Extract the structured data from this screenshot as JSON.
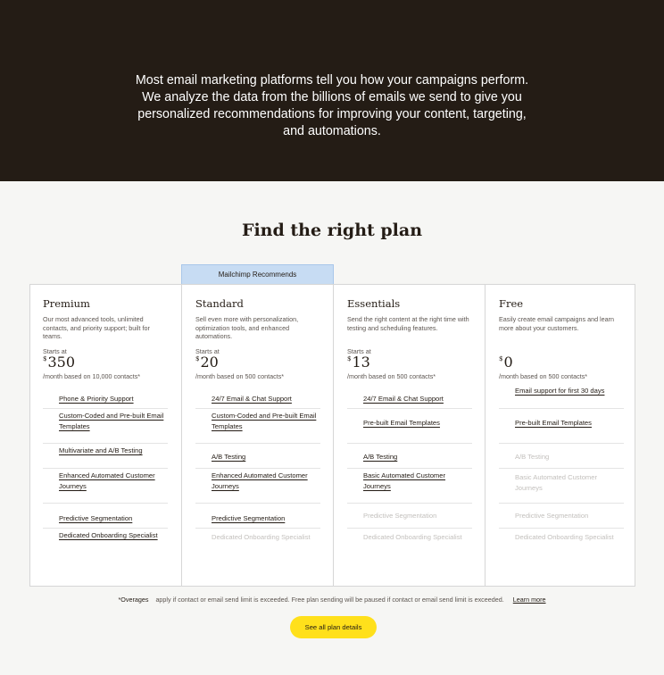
{
  "hero": {
    "text": "Most email marketing platforms tell you how your campaigns perform. We analyze the data from the billions of emails we send to give you personalized recommendations for improving your content, targeting, and automations."
  },
  "plans_section": {
    "title": "Find the right plan",
    "recommended_label": "Mailchimp Recommends"
  },
  "plans": [
    {
      "name": "Premium",
      "description": "Our most advanced tools, unlimited contacts, and priority support; built for teams.",
      "starts_at": "Starts at",
      "currency": "$",
      "price": "350",
      "per_month": "/month based on 10,000 contacts*",
      "features": [
        {
          "label": "Phone & Priority Support",
          "included": true
        },
        {
          "label": "Custom-Coded and Pre-built Email Templates",
          "included": true
        },
        {
          "label": "Multivariate and A/B Testing",
          "included": true
        },
        {
          "label": "Enhanced Automated Customer Journeys",
          "included": true
        },
        {
          "label": "Predictive Segmentation",
          "included": true
        },
        {
          "label": "Dedicated Onboarding Specialist",
          "included": true
        }
      ]
    },
    {
      "name": "Standard",
      "description": "Sell even more with personalization, optimization tools, and enhanced automations.",
      "starts_at": "Starts at",
      "currency": "$",
      "price": "20",
      "per_month": "/month based on 500 contacts*",
      "features": [
        {
          "label": "24/7 Email & Chat Support",
          "included": true
        },
        {
          "label": "Custom-Coded and Pre-built Email Templates",
          "included": true
        },
        {
          "label": "A/B Testing",
          "included": true
        },
        {
          "label": "Enhanced Automated Customer Journeys",
          "included": true
        },
        {
          "label": "Predictive Segmentation",
          "included": true
        },
        {
          "label": "Dedicated Onboarding Specialist",
          "included": false
        }
      ]
    },
    {
      "name": "Essentials",
      "description": "Send the right content at the right time with testing and scheduling features.",
      "starts_at": "Starts at",
      "currency": "$",
      "price": "13",
      "per_month": "/month based on 500 contacts*",
      "features": [
        {
          "label": "24/7 Email & Chat Support",
          "included": true
        },
        {
          "label": "Pre-built Email Templates",
          "included": true
        },
        {
          "label": "A/B Testing",
          "included": true
        },
        {
          "label": "Basic Automated Customer Journeys",
          "included": true
        },
        {
          "label": "Predictive Segmentation",
          "included": false
        },
        {
          "label": "Dedicated Onboarding Specialist",
          "included": false
        }
      ]
    },
    {
      "name": "Free",
      "description": "Easily create email campaigns and learn more about your customers.",
      "starts_at": "",
      "currency": "$",
      "price": "0",
      "per_month": "/month based on 500 contacts*",
      "features": [
        {
          "label": "Email support for first 30 days",
          "included": true
        },
        {
          "label": "Pre-built Email Templates",
          "included": true
        },
        {
          "label": "A/B Testing",
          "included": false
        },
        {
          "label": "Basic Automated Customer Journeys",
          "included": false
        },
        {
          "label": "Predictive Segmentation",
          "included": false
        },
        {
          "label": "Dedicated Onboarding Specialist",
          "included": false
        }
      ]
    }
  ],
  "footer": {
    "overages_label": "*Overages",
    "overages_text": "apply if contact or email send limit is exceeded. Free plan sending will be paused if contact or email send limit is exceeded.",
    "learn_more": "Learn more",
    "cta": "See all plan details"
  },
  "colors": {
    "hero_bg": "#241c15",
    "page_bg": "#f6f6f4",
    "recommend_bg": "#c7dcf3",
    "cta_bg": "#ffe01b"
  }
}
